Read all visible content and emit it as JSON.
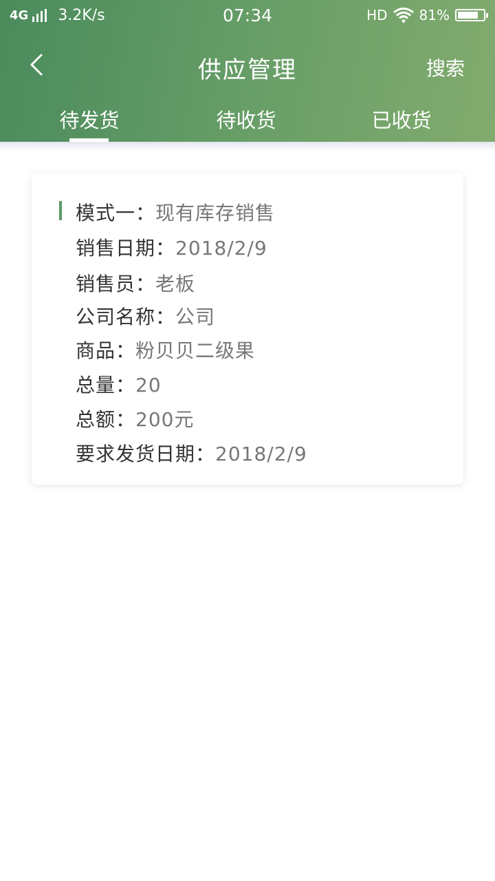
{
  "status_bar": {
    "network": "4G",
    "speed": "3.2K/s",
    "time": "07:34",
    "hd": "HD",
    "battery": "81%",
    "battery_level": 0.81
  },
  "nav": {
    "title": "供应管理",
    "search_label": "搜索"
  },
  "tabs": [
    {
      "label": "待发货",
      "active": true
    },
    {
      "label": "待收货",
      "active": false
    },
    {
      "label": "已收货",
      "active": false
    }
  ],
  "order": {
    "mode": {
      "label": "模式一：",
      "value": "现有库存销售"
    },
    "sale_date": {
      "label": "销售日期：",
      "value": "2018/2/9"
    },
    "salesperson": {
      "label": "销售员：",
      "value": "老板"
    },
    "company": {
      "label": "公司名称：",
      "value": "公司"
    },
    "product": {
      "label": "商品：",
      "value": "粉贝贝二级果"
    },
    "quantity": {
      "label": "总量：",
      "value": "20"
    },
    "amount": {
      "label": "总额：",
      "value": "200元"
    },
    "ship_date": {
      "label": "要求发货日期：",
      "value": "2018/2/9"
    }
  },
  "colors": {
    "header_start": "#4a8b5c",
    "header_end": "#82ab6e",
    "accent": "#5b9a66"
  }
}
